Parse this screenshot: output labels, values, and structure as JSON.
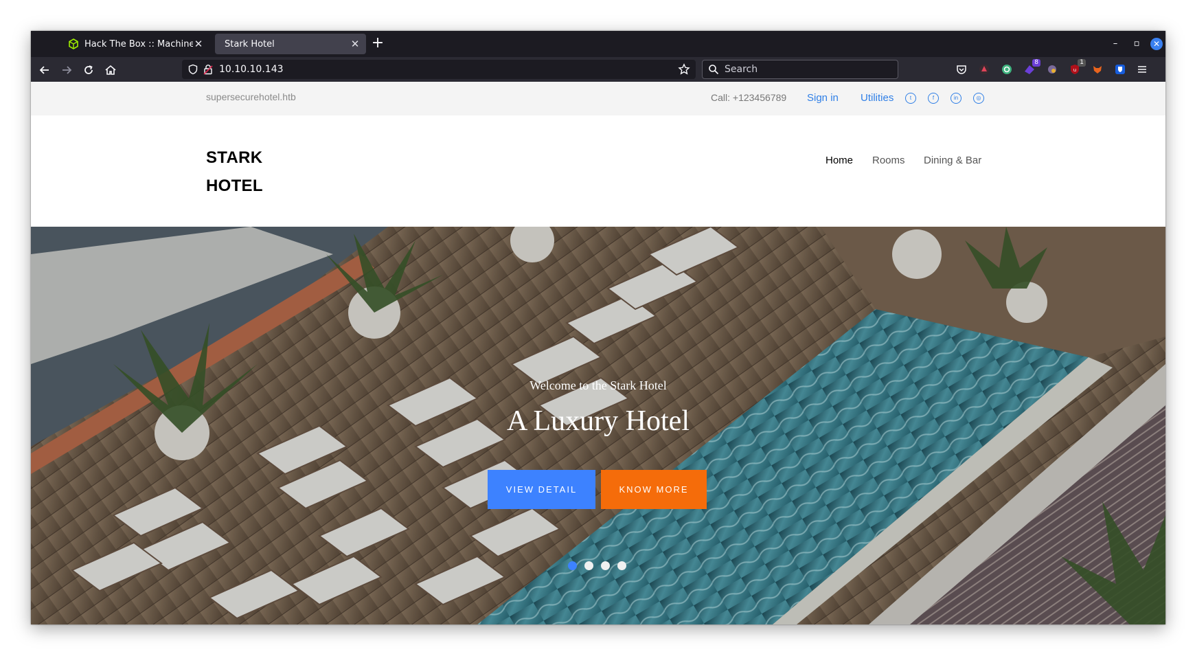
{
  "browser": {
    "tabs": [
      {
        "title": "Hack The Box :: Machines",
        "active": false
      },
      {
        "title": "Stark Hotel",
        "active": true
      }
    ],
    "url": "10.10.10.143",
    "search_placeholder": "Search",
    "extension_badges": {
      "purple": "8",
      "red": "1"
    },
    "colors": {
      "chrome_dark": "#1c1b22",
      "toolbar": "#2b2a33",
      "active_tab": "#42414d"
    }
  },
  "topbar": {
    "domain": "supersecurehotel.htb",
    "call": "Call: +123456789",
    "sign_in": "Sign in",
    "utilities": "Utilities",
    "social_icons": [
      "twitter-icon",
      "facebook-icon",
      "linkedin-icon",
      "instagram-icon"
    ]
  },
  "header": {
    "logo_line1": "STARK",
    "logo_line2": "HOTEL",
    "nav": [
      "Home",
      "Rooms",
      "Dining & Bar"
    ]
  },
  "hero": {
    "welcome": "Welcome to the Stark Hotel",
    "headline": "A Luxury Hotel",
    "view_detail": "VIEW DETAIL",
    "know_more": "KNOW MORE",
    "slides_count": 4,
    "active_slide": 1
  },
  "colors": {
    "accent_blue": "#3d82ff",
    "accent_orange": "#f56c0a",
    "link_blue": "#2f7fe6"
  }
}
